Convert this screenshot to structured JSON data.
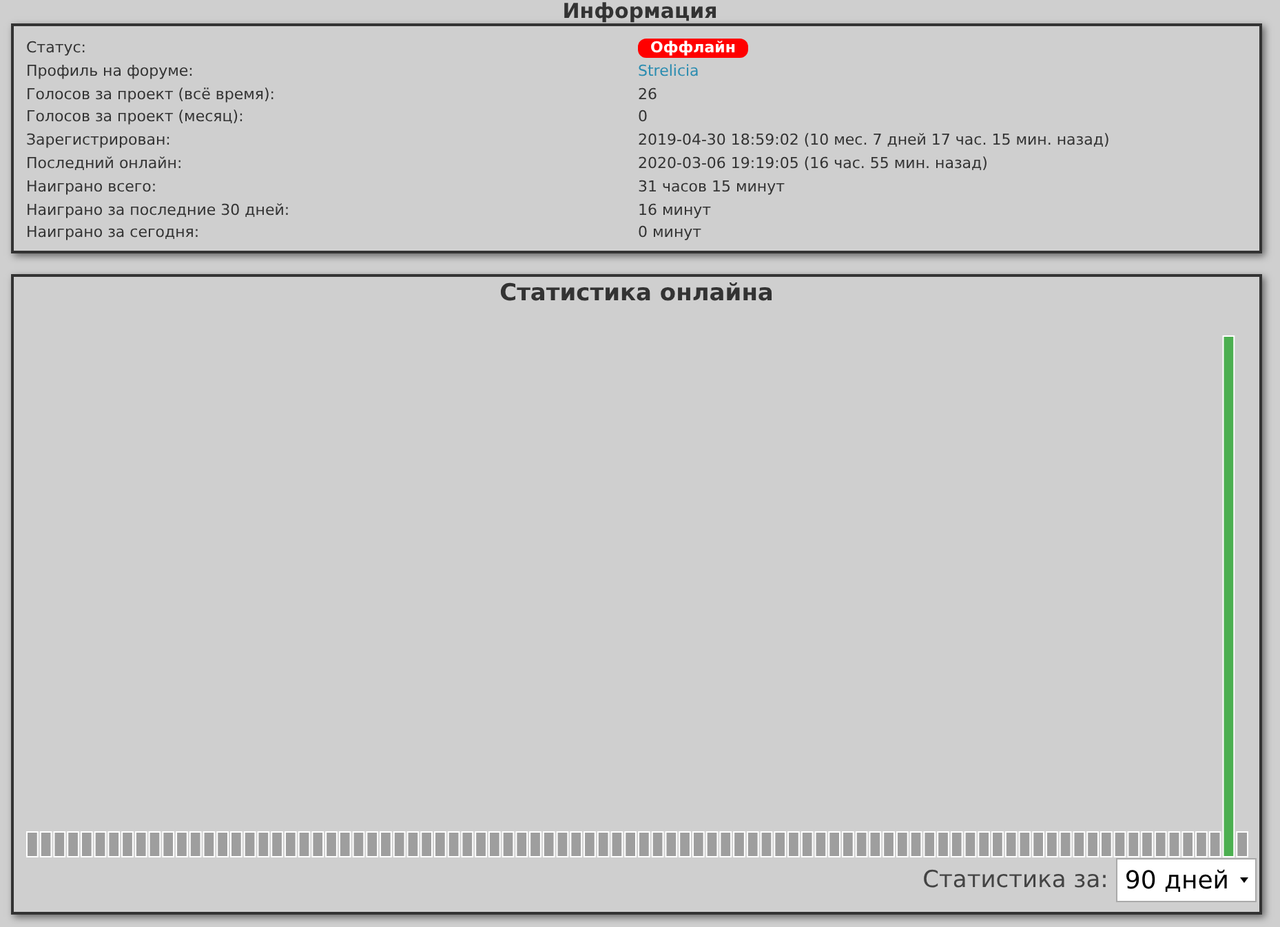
{
  "info": {
    "title": "Информация",
    "rows": [
      {
        "label": "Статус:",
        "value": "Оффлайн",
        "kind": "status"
      },
      {
        "label": "Профиль на форуме:",
        "value": "Strelicia",
        "kind": "link"
      },
      {
        "label": "Голосов за проект (всё время):",
        "value": "26",
        "kind": "text"
      },
      {
        "label": "Голосов за проект (месяц):",
        "value": "0",
        "kind": "text"
      },
      {
        "label": "Зарегистрирован:",
        "value": "2019-04-30 18:59:02 (10 мес. 7 дней 17 час. 15 мин. назад)",
        "kind": "text"
      },
      {
        "label": "Последний онлайн:",
        "value": "2020-03-06 19:19:05 (16 час. 55 мин. назад)",
        "kind": "text"
      },
      {
        "label": "Наиграно всего:",
        "value": "31 часов 15 минут",
        "kind": "text"
      },
      {
        "label": "Наиграно за последние 30 дней:",
        "value": "16 минут",
        "kind": "text"
      },
      {
        "label": "Наиграно за сегодня:",
        "value": "0 минут",
        "kind": "text"
      }
    ]
  },
  "stats": {
    "title": "Статистика онлайна",
    "period_label": "Статистика за:",
    "period_select": "90 дней"
  }
}
